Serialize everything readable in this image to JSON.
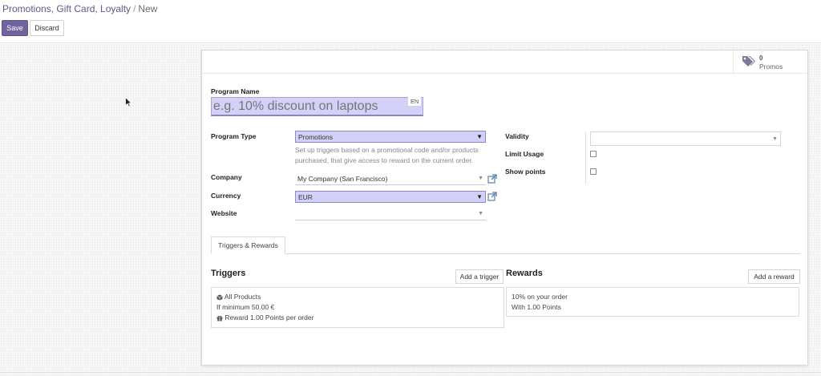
{
  "breadcrumb": {
    "parent": "Promotions, Gift Card, Loyalty",
    "separator": "/",
    "current": "New"
  },
  "toolbar": {
    "save_label": "Save",
    "discard_label": "Discard"
  },
  "stat": {
    "value": "0",
    "label": "Promos"
  },
  "form": {
    "program_name_label": "Program Name",
    "program_name_placeholder": "e.g. 10% discount on laptops",
    "lang": "EN",
    "program_type_label": "Program Type",
    "program_type_value": "Promotions",
    "program_type_help": "Set up triggers based on a promotional code and/or products purchased, that give access to reward on the current order.",
    "company_label": "Company",
    "company_value": "My Company (San Francisco)",
    "currency_label": "Currency",
    "currency_value": "EUR",
    "website_label": "Website",
    "website_value": "",
    "validity_label": "Validity",
    "validity_value": "",
    "limit_usage_label": "Limit Usage",
    "limit_usage_checked": false,
    "show_points_label": "Show points",
    "show_points_checked": false
  },
  "tabs": [
    {
      "label": "Triggers & Rewards",
      "active": true
    }
  ],
  "triggers": {
    "title": "Triggers",
    "add_label": "Add a trigger",
    "card": {
      "product": "All Products",
      "minimum": "If minimum 50.00 €",
      "reward": "Reward 1.00 Points per order"
    }
  },
  "rewards": {
    "title": "Rewards",
    "add_label": "Add a reward",
    "card": {
      "line1": "10% on your order",
      "line2": "With 1.00 Points"
    }
  },
  "colors": {
    "primary": "#71639e",
    "highlight_field": "#d4d1f9",
    "link": "#5b5b8e"
  },
  "icons": [
    "tags-icon",
    "external-link-icon",
    "cube-icon",
    "gift-icon",
    "chevron-down-icon",
    "mouse-cursor-icon"
  ]
}
